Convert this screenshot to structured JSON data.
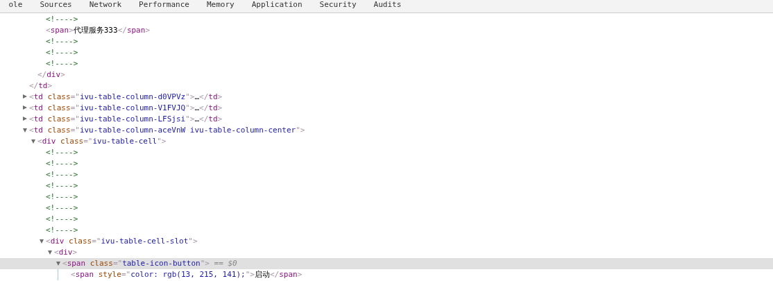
{
  "tabs": [
    {
      "label": "ole",
      "selected": false
    },
    {
      "label": "Sources",
      "selected": false
    },
    {
      "label": "Network",
      "selected": false
    },
    {
      "label": "Performance",
      "selected": false
    },
    {
      "label": "Memory",
      "selected": false
    },
    {
      "label": "Application",
      "selected": false
    },
    {
      "label": "Security",
      "selected": false
    },
    {
      "label": "Audits",
      "selected": false
    }
  ],
  "dom_tree": [
    {
      "children": [
        {
          "children": [
            {
              "selected": false,
              "tokens": [
                {
                  "kind": "comment",
                  "text": "<!---->"
                }
              ]
            },
            {
              "selected": false,
              "tokens": [
                {
                  "kind": "punct",
                  "text": "<"
                },
                {
                  "kind": "tag",
                  "text": "span"
                },
                {
                  "kind": "punct",
                  "text": ">"
                },
                {
                  "kind": "text",
                  "text": "代理服务333"
                },
                {
                  "kind": "punct",
                  "text": "</"
                },
                {
                  "kind": "tag",
                  "text": "span"
                },
                {
                  "kind": "punct",
                  "text": ">"
                }
              ]
            },
            {
              "selected": false,
              "tokens": [
                {
                  "kind": "comment",
                  "text": "<!---->"
                }
              ]
            },
            {
              "selected": false,
              "tokens": [
                {
                  "kind": "comment",
                  "text": "<!---->"
                }
              ]
            },
            {
              "selected": false,
              "tokens": [
                {
                  "kind": "comment",
                  "text": "<!---->"
                }
              ]
            }
          ],
          "close": [
            {
              "kind": "punct",
              "text": "</"
            },
            {
              "kind": "tag",
              "text": "div"
            },
            {
              "kind": "punct",
              "text": ">"
            }
          ]
        }
      ],
      "close": [
        {
          "kind": "punct",
          "text": "</"
        },
        {
          "kind": "tag",
          "text": "td"
        },
        {
          "kind": "punct",
          "text": ">"
        }
      ]
    },
    {
      "expanded": false,
      "selected": false,
      "tokens": [
        {
          "kind": "punct",
          "text": "<"
        },
        {
          "kind": "tag",
          "text": "td"
        },
        {
          "kind": "attr",
          "text": " class"
        },
        {
          "kind": "punct",
          "text": "=\""
        },
        {
          "kind": "value",
          "text": "ivu-table-column-d0VPVz"
        },
        {
          "kind": "punct",
          "text": "\">"
        },
        {
          "kind": "text",
          "text": "…"
        },
        {
          "kind": "punct",
          "text": "</"
        },
        {
          "kind": "tag",
          "text": "td"
        },
        {
          "kind": "punct",
          "text": ">"
        }
      ]
    },
    {
      "expanded": false,
      "selected": false,
      "tokens": [
        {
          "kind": "punct",
          "text": "<"
        },
        {
          "kind": "tag",
          "text": "td"
        },
        {
          "kind": "attr",
          "text": " class"
        },
        {
          "kind": "punct",
          "text": "=\""
        },
        {
          "kind": "value",
          "text": "ivu-table-column-V1FVJQ"
        },
        {
          "kind": "punct",
          "text": "\">"
        },
        {
          "kind": "text",
          "text": "…"
        },
        {
          "kind": "punct",
          "text": "</"
        },
        {
          "kind": "tag",
          "text": "td"
        },
        {
          "kind": "punct",
          "text": ">"
        }
      ]
    },
    {
      "expanded": false,
      "selected": false,
      "tokens": [
        {
          "kind": "punct",
          "text": "<"
        },
        {
          "kind": "tag",
          "text": "td"
        },
        {
          "kind": "attr",
          "text": " class"
        },
        {
          "kind": "punct",
          "text": "=\""
        },
        {
          "kind": "value",
          "text": "ivu-table-column-LFSjsi"
        },
        {
          "kind": "punct",
          "text": "\">"
        },
        {
          "kind": "text",
          "text": "…"
        },
        {
          "kind": "punct",
          "text": "</"
        },
        {
          "kind": "tag",
          "text": "td"
        },
        {
          "kind": "punct",
          "text": ">"
        }
      ]
    },
    {
      "expanded": true,
      "selected": false,
      "tokens": [
        {
          "kind": "punct",
          "text": "<"
        },
        {
          "kind": "tag",
          "text": "td"
        },
        {
          "kind": "attr",
          "text": " class"
        },
        {
          "kind": "punct",
          "text": "=\""
        },
        {
          "kind": "value",
          "text": "ivu-table-column-aceVnW ivu-table-column-center"
        },
        {
          "kind": "punct",
          "text": "\">"
        }
      ],
      "children": [
        {
          "expanded": true,
          "selected": false,
          "tokens": [
            {
              "kind": "punct",
              "text": "<"
            },
            {
              "kind": "tag",
              "text": "div"
            },
            {
              "kind": "attr",
              "text": " class"
            },
            {
              "kind": "punct",
              "text": "=\""
            },
            {
              "kind": "value",
              "text": "ivu-table-cell"
            },
            {
              "kind": "punct",
              "text": "\">"
            }
          ],
          "children": [
            {
              "selected": false,
              "tokens": [
                {
                  "kind": "comment",
                  "text": "<!---->"
                }
              ]
            },
            {
              "selected": false,
              "tokens": [
                {
                  "kind": "comment",
                  "text": "<!---->"
                }
              ]
            },
            {
              "selected": false,
              "tokens": [
                {
                  "kind": "comment",
                  "text": "<!---->"
                }
              ]
            },
            {
              "selected": false,
              "tokens": [
                {
                  "kind": "comment",
                  "text": "<!---->"
                }
              ]
            },
            {
              "selected": false,
              "tokens": [
                {
                  "kind": "comment",
                  "text": "<!---->"
                }
              ]
            },
            {
              "selected": false,
              "tokens": [
                {
                  "kind": "comment",
                  "text": "<!---->"
                }
              ]
            },
            {
              "selected": false,
              "tokens": [
                {
                  "kind": "comment",
                  "text": "<!---->"
                }
              ]
            },
            {
              "selected": false,
              "tokens": [
                {
                  "kind": "comment",
                  "text": "<!---->"
                }
              ]
            },
            {
              "expanded": true,
              "selected": false,
              "tokens": [
                {
                  "kind": "punct",
                  "text": "<"
                },
                {
                  "kind": "tag",
                  "text": "div"
                },
                {
                  "kind": "attr",
                  "text": " class"
                },
                {
                  "kind": "punct",
                  "text": "=\""
                },
                {
                  "kind": "value",
                  "text": "ivu-table-cell-slot"
                },
                {
                  "kind": "punct",
                  "text": "\">"
                }
              ],
              "children": [
                {
                  "expanded": true,
                  "selected": false,
                  "tokens": [
                    {
                      "kind": "punct",
                      "text": "<"
                    },
                    {
                      "kind": "tag",
                      "text": "div"
                    },
                    {
                      "kind": "punct",
                      "text": ">"
                    }
                  ],
                  "children": [
                    {
                      "expanded": true,
                      "selected": true,
                      "tokens": [
                        {
                          "kind": "punct",
                          "text": "<"
                        },
                        {
                          "kind": "tag",
                          "text": "span"
                        },
                        {
                          "kind": "attr",
                          "text": " class"
                        },
                        {
                          "kind": "punct",
                          "text": "=\""
                        },
                        {
                          "kind": "value",
                          "text": "table-icon-button"
                        },
                        {
                          "kind": "punct",
                          "text": "\">"
                        },
                        {
                          "kind": "marker",
                          "text": " == "
                        },
                        {
                          "kind": "var",
                          "text": "$0"
                        }
                      ],
                      "children": [
                        {
                          "selected": false,
                          "tokens": [
                            {
                              "kind": "punct",
                              "text": "<"
                            },
                            {
                              "kind": "tag",
                              "text": "span"
                            },
                            {
                              "kind": "attr",
                              "text": " style"
                            },
                            {
                              "kind": "punct",
                              "text": "=\""
                            },
                            {
                              "kind": "value",
                              "text": "color: rgb(13, 215, 141);"
                            },
                            {
                              "kind": "punct",
                              "text": "\">"
                            },
                            {
                              "kind": "text",
                              "text": "启动"
                            },
                            {
                              "kind": "punct",
                              "text": "</"
                            },
                            {
                              "kind": "tag",
                              "text": "span"
                            },
                            {
                              "kind": "punct",
                              "text": ">"
                            }
                          ]
                        }
                      ]
                    }
                  ]
                }
              ]
            }
          ]
        }
      ]
    }
  ]
}
